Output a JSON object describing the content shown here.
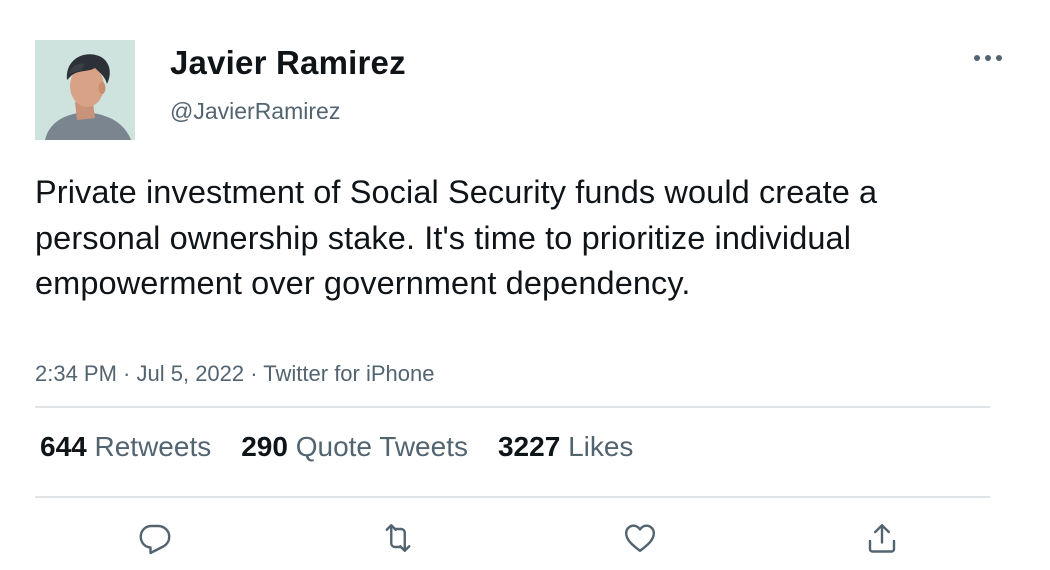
{
  "author": {
    "display_name": "Javier Ramirez",
    "handle": "@JavierRamirez"
  },
  "tweet": {
    "text": "Private investment of Social Security funds would create a personal ownership stake. It's time to prioritize individual empowerment over government dependency.",
    "time": "2:34 PM",
    "date": "Jul 5, 2022",
    "source": "Twitter for iPhone",
    "separator": " · "
  },
  "stats": {
    "retweets_count": "644",
    "retweets_label": "Retweets",
    "quotes_count": "290",
    "quotes_label": "Quote Tweets",
    "likes_count": "3227",
    "likes_label": "Likes"
  },
  "icons": {
    "more": "more-horizontal-icon",
    "reply": "reply-icon",
    "retweet": "retweet-icon",
    "like": "heart-icon",
    "share": "share-icon"
  },
  "colors": {
    "text_primary": "#0f1419",
    "text_secondary": "#536471",
    "divider": "#e1e4e7",
    "icon": "#536471"
  }
}
